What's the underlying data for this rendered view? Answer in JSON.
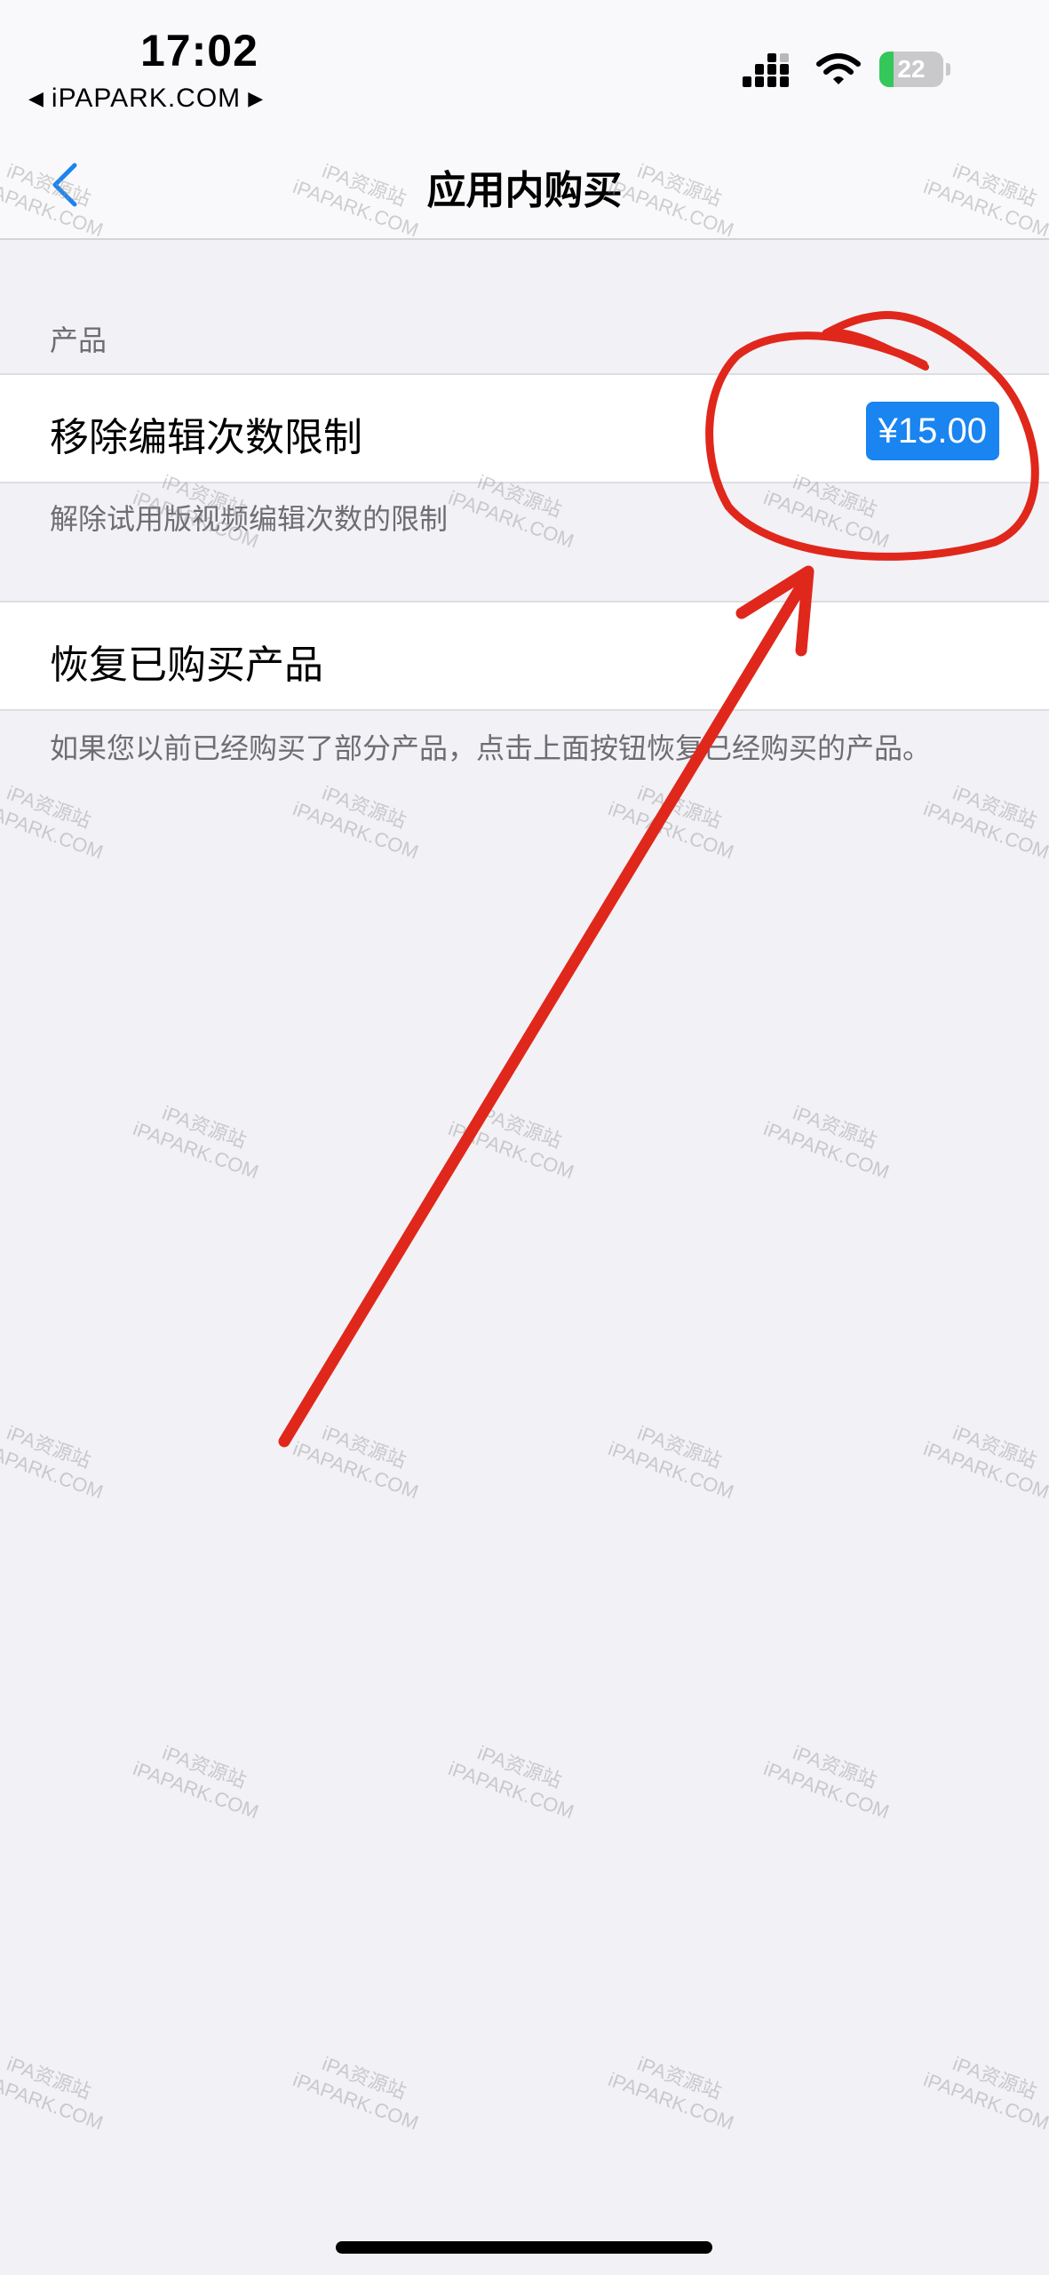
{
  "status_bar": {
    "time": "17:02",
    "back_app": "iPAPARK.COM",
    "battery_level": "22",
    "battery_fraction": 0.22
  },
  "nav": {
    "title": "应用内购买"
  },
  "products_section": {
    "header": "产品",
    "item": {
      "label": "移除编辑次数限制",
      "price": "¥15.00"
    },
    "footer": "解除试用版视频编辑次数的限制"
  },
  "restore_section": {
    "label": "恢复已购买产品",
    "footer": "如果您以前已经购买了部分产品，点击上面按钮恢复已经购买的产品。"
  },
  "watermark": {
    "line1": "iPA资源站",
    "line2": "iPAPARK.COM"
  },
  "colors": {
    "accent": "#1a84f0",
    "annotation": "#e0271b",
    "background": "#f2f1f6"
  }
}
